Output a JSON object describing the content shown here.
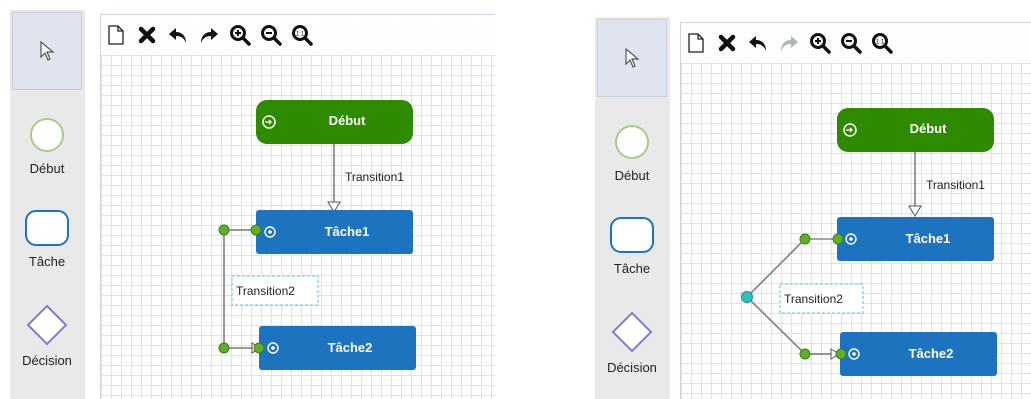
{
  "sidebar": {
    "tools": [
      {
        "id": "pointer",
        "label": ""
      },
      {
        "id": "start",
        "label": "Début"
      },
      {
        "id": "task",
        "label": "Tâche"
      },
      {
        "id": "decision",
        "label": "Décision"
      }
    ]
  },
  "nodes": {
    "start_label": "Début",
    "task1_label": "Tâche1",
    "task2_label": "Tâche2"
  },
  "edges": {
    "transition1": "Transition1",
    "transition2": "Transition2"
  },
  "colors": {
    "start_fill": "#2e8b00",
    "task_fill": "#1e73be",
    "handle_green": "#5faf2c",
    "handle_teal": "#2ec4c4",
    "redo_disabled": "#a9b7b7"
  },
  "toolbar": {
    "buttons": [
      "new-document-icon",
      "delete-icon",
      "undo-icon",
      "redo-icon",
      "zoom-in-icon",
      "zoom-out-icon",
      "zoom-reset-icon"
    ]
  }
}
